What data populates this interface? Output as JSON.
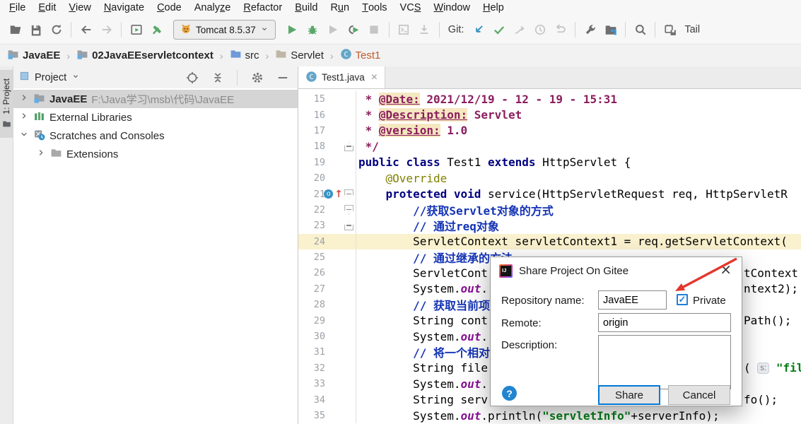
{
  "menu": {
    "items": [
      {
        "label": "File",
        "mnemonic": 0
      },
      {
        "label": "Edit",
        "mnemonic": 0
      },
      {
        "label": "View",
        "mnemonic": 0
      },
      {
        "label": "Navigate",
        "mnemonic": 0
      },
      {
        "label": "Code",
        "mnemonic": 0
      },
      {
        "label": "Analyze",
        "mnemonic": 5
      },
      {
        "label": "Refactor",
        "mnemonic": 0
      },
      {
        "label": "Build",
        "mnemonic": 0
      },
      {
        "label": "Run",
        "mnemonic": 1
      },
      {
        "label": "Tools",
        "mnemonic": 0
      },
      {
        "label": "VCS",
        "mnemonic": 2
      },
      {
        "label": "Window",
        "mnemonic": 0
      },
      {
        "label": "Help",
        "mnemonic": 0
      }
    ]
  },
  "toolbar": {
    "git_label": "Git:",
    "tail_label": "Tail",
    "tomcat_label": "Tomcat 8.5.37",
    "items": [
      {
        "icon": "open-folder"
      },
      {
        "icon": "save"
      },
      {
        "icon": "sync"
      },
      {
        "sep": true
      },
      {
        "icon": "arrow-back"
      },
      {
        "icon": "arrow-forward",
        "disabled": true
      },
      {
        "sep": true
      },
      {
        "icon": "run-window"
      },
      {
        "icon": "hammer"
      },
      {
        "widget": "tomcat-select"
      },
      {
        "icon": "run"
      },
      {
        "icon": "debug"
      },
      {
        "icon": "play",
        "disabled": true
      },
      {
        "icon": "run-coverage"
      },
      {
        "icon": "stop",
        "disabled": true
      },
      {
        "sep": true
      },
      {
        "icon": "terminal",
        "disabled": true
      },
      {
        "icon": "download",
        "disabled": true
      },
      {
        "sep": true
      },
      {
        "label_key": "git_label"
      },
      {
        "icon": "git-update"
      },
      {
        "icon": "git-commit"
      },
      {
        "icon": "git-merge",
        "disabled": true
      },
      {
        "icon": "history",
        "disabled": true
      },
      {
        "icon": "rollback",
        "disabled": true
      },
      {
        "sep": true
      },
      {
        "icon": "wrench"
      },
      {
        "icon": "project-structure"
      },
      {
        "sep": true
      },
      {
        "icon": "search"
      },
      {
        "sep": true
      },
      {
        "icon": "plugin"
      },
      {
        "label_key": "tail_label"
      }
    ]
  },
  "breadcrumb": {
    "separator": "›",
    "items": [
      {
        "label": "JavaEE",
        "icon": "module-folder",
        "bold": true
      },
      {
        "label": "02JavaEEservletcontext",
        "icon": "module-folder",
        "bold": true
      },
      {
        "label": "src",
        "icon": "src-folder",
        "bold": false
      },
      {
        "label": "Servlet",
        "icon": "folder-servlet",
        "bold": false
      },
      {
        "label": "Test1",
        "icon": "class",
        "bold": false,
        "color": "#BC5B2A"
      }
    ]
  },
  "stripe": {
    "label": "1: Project"
  },
  "project": {
    "title": "Project",
    "tree": [
      {
        "chevron": "right",
        "icon": "module-folder",
        "label": "JavaEE",
        "path": " F:\\Java学习\\msb\\代码\\JavaEE",
        "selected": true,
        "bold": true,
        "indent": 0
      },
      {
        "chevron": "right",
        "icon": "libraries",
        "label": "External Libraries",
        "selected": false,
        "bold": false,
        "indent": 0
      },
      {
        "chevron": "down",
        "icon": "scratches",
        "label": "Scratches and Consoles",
        "selected": false,
        "bold": false,
        "indent": 0
      },
      {
        "chevron": "right",
        "icon": "folder",
        "label": "Extensions",
        "selected": false,
        "bold": false,
        "indent": 1
      }
    ]
  },
  "editor": {
    "tab": "Test1.java",
    "lines": [
      {
        "n": 15,
        "seg": [
          {
            "t": " * ",
            "c": "d"
          },
          {
            "t": "@Date:",
            "c": "t"
          },
          {
            "t": " 2021/12/19 - 12 - 19 - 15:31",
            "c": "d"
          }
        ]
      },
      {
        "n": 16,
        "seg": [
          {
            "t": " * ",
            "c": "d"
          },
          {
            "t": "@Description:",
            "c": "t"
          },
          {
            "t": " Servlet",
            "c": "d"
          }
        ]
      },
      {
        "n": 17,
        "seg": [
          {
            "t": " * ",
            "c": "d"
          },
          {
            "t": "@version:",
            "c": "t"
          },
          {
            "t": " 1.0",
            "c": "d"
          }
        ]
      },
      {
        "n": 18,
        "fold": "up",
        "seg": [
          {
            "t": " */",
            "c": "d"
          }
        ]
      },
      {
        "n": 19,
        "seg": [
          {
            "t": "public",
            "c": "k"
          },
          {
            "t": " ",
            "c": "p"
          },
          {
            "t": "class",
            "c": "k"
          },
          {
            "t": " Test1 ",
            "c": "p"
          },
          {
            "t": "extends",
            "c": "k"
          },
          {
            "t": " HttpServlet {",
            "c": "p"
          }
        ]
      },
      {
        "n": 20,
        "seg": [
          {
            "t": "    ",
            "c": "p"
          },
          {
            "t": "@Override",
            "c": "a"
          }
        ]
      },
      {
        "n": 21,
        "marker": "override",
        "fold": "down",
        "seg": [
          {
            "t": "    ",
            "c": "p"
          },
          {
            "t": "protected",
            "c": "k"
          },
          {
            "t": " ",
            "c": "p"
          },
          {
            "t": "void",
            "c": "k"
          },
          {
            "t": " service(HttpServletRequest req, HttpServletR",
            "c": "p"
          }
        ]
      },
      {
        "n": 22,
        "fold": "down",
        "seg": [
          {
            "t": "        ",
            "c": "p"
          },
          {
            "t": "//获取Servlet对象的方式",
            "c": "c"
          }
        ]
      },
      {
        "n": 23,
        "fold": "up",
        "seg": [
          {
            "t": "        ",
            "c": "p"
          },
          {
            "t": "// 通过req对象",
            "c": "c"
          }
        ]
      },
      {
        "n": 24,
        "highlight": true,
        "seg": [
          {
            "t": "        ServletContext servletContext1 = req.getServletContext(",
            "c": "p"
          }
        ]
      },
      {
        "n": 25,
        "seg": [
          {
            "t": "        ",
            "c": "p"
          },
          {
            "t": "// 通过继承的方法",
            "c": "c"
          }
        ]
      },
      {
        "n": 26,
        "seg": [
          {
            "t": "        ServletCont",
            "c": "p"
          }
        ],
        "right": [
          {
            "t": "tContext",
            "c": "p"
          }
        ]
      },
      {
        "n": 27,
        "seg": [
          {
            "t": "        System.",
            "c": "p"
          },
          {
            "t": "out",
            "c": "f"
          },
          {
            "t": ".",
            "c": "p"
          }
        ],
        "right": [
          {
            "t": "ntext2);",
            "c": "p"
          }
        ]
      },
      {
        "n": 28,
        "seg": [
          {
            "t": "        ",
            "c": "p"
          },
          {
            "t": "// 获取当前项",
            "c": "c"
          }
        ]
      },
      {
        "n": 29,
        "seg": [
          {
            "t": "        String cont",
            "c": "p"
          }
        ],
        "right": [
          {
            "t": "Path();",
            "c": "p"
          }
        ]
      },
      {
        "n": 30,
        "seg": [
          {
            "t": "        System.",
            "c": "p"
          },
          {
            "t": "out",
            "c": "f"
          },
          {
            "t": ".",
            "c": "p"
          }
        ]
      },
      {
        "n": 31,
        "seg": [
          {
            "t": "        ",
            "c": "p"
          },
          {
            "t": "// 将一个相对",
            "c": "c"
          }
        ]
      },
      {
        "n": 32,
        "seg": [
          {
            "t": "        String file",
            "c": "p"
          }
        ],
        "right": [
          {
            "t": "( ",
            "c": "p"
          },
          {
            "t": "s:",
            "c": "h"
          },
          {
            "t": " ",
            "c": "p"
          },
          {
            "t": "\"file",
            "c": "s"
          }
        ]
      },
      {
        "n": 33,
        "seg": [
          {
            "t": "        System.",
            "c": "p"
          },
          {
            "t": "out",
            "c": "f"
          },
          {
            "t": ".",
            "c": "p"
          }
        ]
      },
      {
        "n": 34,
        "seg": [
          {
            "t": "        String serv",
            "c": "p"
          }
        ],
        "right": [
          {
            "t": "fo();",
            "c": "p"
          }
        ]
      },
      {
        "n": 35,
        "seg": [
          {
            "t": "        System.",
            "c": "p"
          },
          {
            "t": "out",
            "c": "f"
          },
          {
            "t": ".println(",
            "c": "p"
          },
          {
            "t": "\"servletInfo\"",
            "c": "s"
          },
          {
            "t": "+serverInfo);",
            "c": "p"
          }
        ]
      }
    ]
  },
  "dialog": {
    "title": "Share Project On Gitee",
    "repository_label": "Repository name:",
    "repository_value": "JavaEE",
    "private_label": "Private",
    "private_checked": true,
    "remote_label": "Remote:",
    "remote_value": "origin",
    "description_label": "Description:",
    "description_value": "",
    "share_label": "Share",
    "cancel_label": "Cancel",
    "help_label": "?"
  },
  "colors": {
    "accent": "#0078D7",
    "annotation_arrow": "#E3372E",
    "run_green": "#59A869",
    "git_update_blue": "#3592C4",
    "keyword": "#000080",
    "comment": "#1433B5",
    "doc_comment": "#8B1E5E",
    "doc_tag_background": "#F5E7C0",
    "string": "#067D17",
    "static_field": "#871094",
    "annotation": "#808000",
    "current_line": "#FAF1CE",
    "selected_row": "#D5D5D5"
  }
}
